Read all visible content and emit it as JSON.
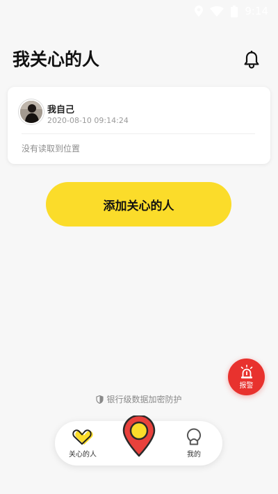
{
  "status_bar": {
    "time": "9:14",
    "icons": [
      "location-icon",
      "wifi-icon",
      "battery-icon"
    ]
  },
  "header": {
    "title": "我关心的人",
    "bell_icon": "bell-icon"
  },
  "people": [
    {
      "name": "我自己",
      "time": "2020-08-10 09:14:24",
      "location_status": "没有读取到位置"
    }
  ],
  "add_button": {
    "label": "添加关心的人"
  },
  "alarm": {
    "label": "报警",
    "color": "#e8322e"
  },
  "security_note": {
    "text": "银行级数据加密防护"
  },
  "bottom_nav": {
    "items": [
      {
        "label": "关心的人",
        "icon": "heart-icon",
        "active": true
      },
      {
        "label": "",
        "icon": "map-pin-icon"
      },
      {
        "label": "我的",
        "icon": "profile-icon"
      }
    ]
  },
  "colors": {
    "accent": "#fbdc2a",
    "pin": "#e8413c",
    "background": "#f7f7f7"
  }
}
